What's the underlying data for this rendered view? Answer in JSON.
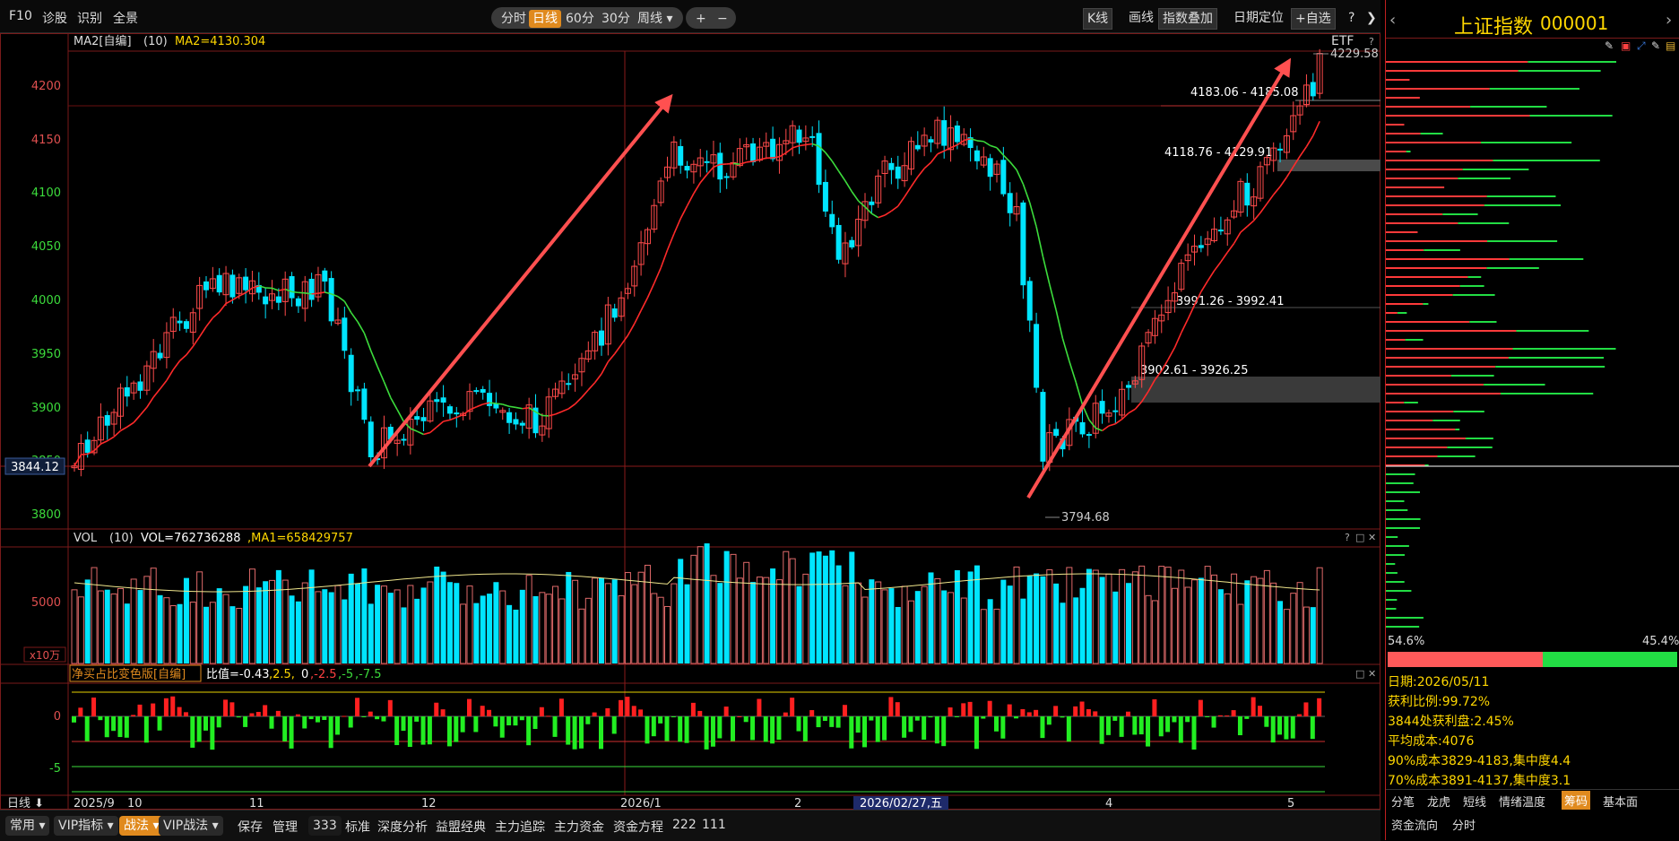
{
  "toolbar": {
    "f10": "F10",
    "diag": "诊股",
    "identify": "识别",
    "panorama": "全景",
    "period_tabs": [
      "分时",
      "日线",
      "60分",
      "30分",
      "周线 ▾"
    ],
    "active_period": "日线",
    "zoom_in": "+",
    "zoom_out": "−",
    "kline": "K线",
    "draw": "画线",
    "index_overlay": "指数叠加",
    "date_locate": "日期定位",
    "watchlist": "+自选",
    "help": "?",
    "collapse": "❯"
  },
  "main_chart": {
    "indicator_label": "MA2[自编]",
    "indicator_param": "(10)",
    "indicator_value": "MA2=4130.304",
    "etf": "ETF",
    "y_ticks": [
      "4200",
      "4150",
      "4100",
      "4050",
      "4000",
      "3950",
      "3900",
      "3850",
      "3800"
    ],
    "crosshair_label": "3844.12",
    "high_label": "4229.58",
    "low_label": "3794.68",
    "zones": [
      "4183.06 - 4185.08",
      "4118.76 - 4129.91",
      "3991.26 - 3992.41",
      "3902.61 - 3926.25"
    ]
  },
  "vol_chart": {
    "label": "VOL",
    "param": "(10)",
    "value": "VOL=762736288",
    "ma": ",MA1=658429757",
    "y_tick": "5000",
    "unit": "x10万"
  },
  "net_chart": {
    "label": "净买占比变色版[自编]",
    "value_prefix": "比值=-0.43",
    "params": [
      ",2.5,",
      "0",
      ",-2.5",
      ",-5",
      ",-7.5"
    ],
    "y_ticks": [
      "0",
      "-5"
    ]
  },
  "x_axis": {
    "period": "日线",
    "labels": [
      "2025/9",
      "10",
      "11",
      "12",
      "2026/1",
      "2",
      "4",
      "5"
    ],
    "cursor_date": "2026/02/27,五"
  },
  "footer": {
    "items": [
      "常用",
      "VIP指标",
      "战法",
      "VIP战法",
      "保存",
      "管理",
      "333",
      "标准",
      "深度分析",
      "益盟经典",
      "主力追踪",
      "主力资金",
      "资金方程",
      "222",
      "111"
    ]
  },
  "right_panel": {
    "name": "上证指数",
    "code": "000001",
    "left_pct": "54.6%",
    "right_pct": "45.4%",
    "stats": [
      "日期:2026/05/11",
      "获利比例:99.72%",
      "3844处获利盘:2.45%",
      "平均成本:4076",
      "90%成本3829-4183,集中度4.4",
      "70%成本3891-4137,集中度3.1"
    ],
    "tabs1": [
      "分笔",
      "龙虎",
      "短线",
      "情绪温度",
      "筹码",
      "基本面"
    ],
    "active_tab": "筹码",
    "tabs2": [
      "资金流向",
      "分时"
    ]
  },
  "colors": {
    "up": "#ff4b4b",
    "down": "#00e5ff",
    "ma_up": "#ff2a2a",
    "ma_down": "#3cdc3c",
    "accent": "#e08a1e",
    "title": "#ffd700"
  }
}
